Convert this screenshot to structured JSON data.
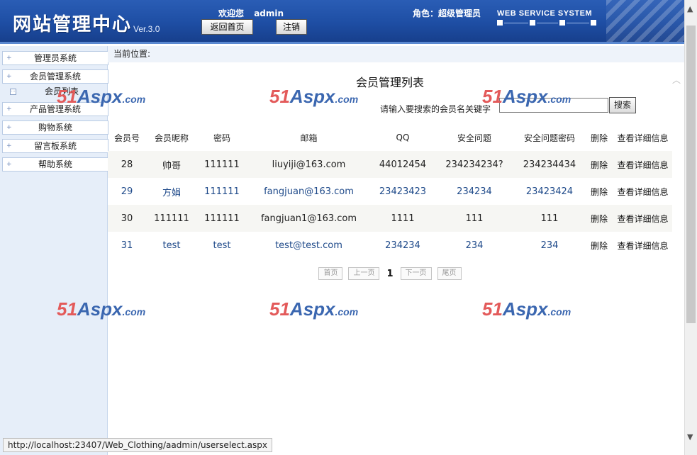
{
  "header": {
    "title": "网站管理中心",
    "version": "Ver.3.0",
    "welcome_label": "欢迎您",
    "username": "admin",
    "home_button": "返回首页",
    "logout_button": "注销",
    "role_label": "角色：超级管理员",
    "system_name": "WEB SERVICE SYSTEM"
  },
  "sidebar": {
    "items": [
      {
        "label": "管理员系统"
      },
      {
        "label": "会员管理系统"
      },
      {
        "label": "会员列表"
      },
      {
        "label": "产品管理系统"
      },
      {
        "label": "购物系统"
      },
      {
        "label": "留言板系统"
      },
      {
        "label": "帮助系统"
      }
    ]
  },
  "breadcrumb": "当前位置:",
  "main": {
    "title": "会员管理列表",
    "search_label": "请输入要搜索的会员名关键字",
    "search_value": "",
    "search_button": "搜索"
  },
  "table": {
    "headers": [
      "会员号",
      "会员昵称",
      "密码",
      "邮箱",
      "QQ",
      "安全问题",
      "安全问题密码",
      "删除",
      "查看详细信息"
    ],
    "rows": [
      [
        "28",
        "帅哥",
        "111111",
        "liuyiji@163.com",
        "44012454",
        "234234234?",
        "234234434",
        "删除",
        "查看详细信息"
      ],
      [
        "29",
        "方娟",
        "111111",
        "fangjuan@163.com",
        "23423423",
        "234234",
        "23423424",
        "删除",
        "查看详细信息"
      ],
      [
        "30",
        "111111",
        "111111",
        "fangjuan1@163.com",
        "1111",
        "111",
        "111",
        "删除",
        "查看详细信息"
      ],
      [
        "31",
        "test",
        "test",
        "test@test.com",
        "234234",
        "234",
        "234",
        "删除",
        "查看详细信息"
      ]
    ]
  },
  "pager": {
    "first": "首页",
    "prev": "上一页",
    "current": "1",
    "next": "下一页",
    "last": "尾页"
  },
  "watermark": {
    "part1": "51",
    "part2": "Aspx",
    "part3": ".com"
  },
  "status_url": "http://localhost:23407/Web_Clothing/aadmin/userselect.aspx",
  "colors": {
    "header_blue": "#1e4ea4",
    "sidebar_bg": "#e6eef9",
    "row_alt": "#f6f6f3",
    "link_blue": "#1f4a8a"
  }
}
